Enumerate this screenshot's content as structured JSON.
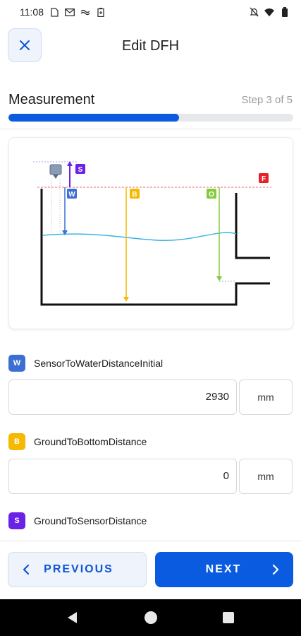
{
  "status_bar": {
    "time": "11:08",
    "left_icons": [
      "sim-card-icon",
      "gmail-icon",
      "cast-icon",
      "battery-saver-icon"
    ],
    "right_icons": [
      "notifications-off-icon",
      "wifi-icon",
      "battery-icon"
    ]
  },
  "header": {
    "title": "Edit DFH",
    "close_icon": "close-icon"
  },
  "progress": {
    "section_title": "Measurement",
    "step_label": "Step 3 of 5",
    "fraction": 0.6
  },
  "diagram": {
    "labels": {
      "sensor": "S",
      "water": "W",
      "bottom": "B",
      "outlet": "O",
      "flood": "F"
    },
    "colors": {
      "S": "#6a22e6",
      "W": "#3b6fd4",
      "B": "#f6b800",
      "O": "#84cc3a",
      "F": "#e8222a",
      "water_line": "#3ab4e6"
    }
  },
  "fields": [
    {
      "badge": "W",
      "badge_color": "#3b6fd4",
      "label": "SensorToWaterDistanceInitial",
      "value": "2930",
      "unit": "mm"
    },
    {
      "badge": "B",
      "badge_color": "#f6b800",
      "label": "GroundToBottomDistance",
      "value": "0",
      "unit": "mm"
    },
    {
      "badge": "S",
      "badge_color": "#6a22e6",
      "label": "GroundToSensorDistance"
    }
  ],
  "buttons": {
    "previous": "PREVIOUS",
    "next": "NEXT"
  },
  "theme": {
    "accent": "#0b5be0",
    "accent_light": "#eef3fc"
  }
}
